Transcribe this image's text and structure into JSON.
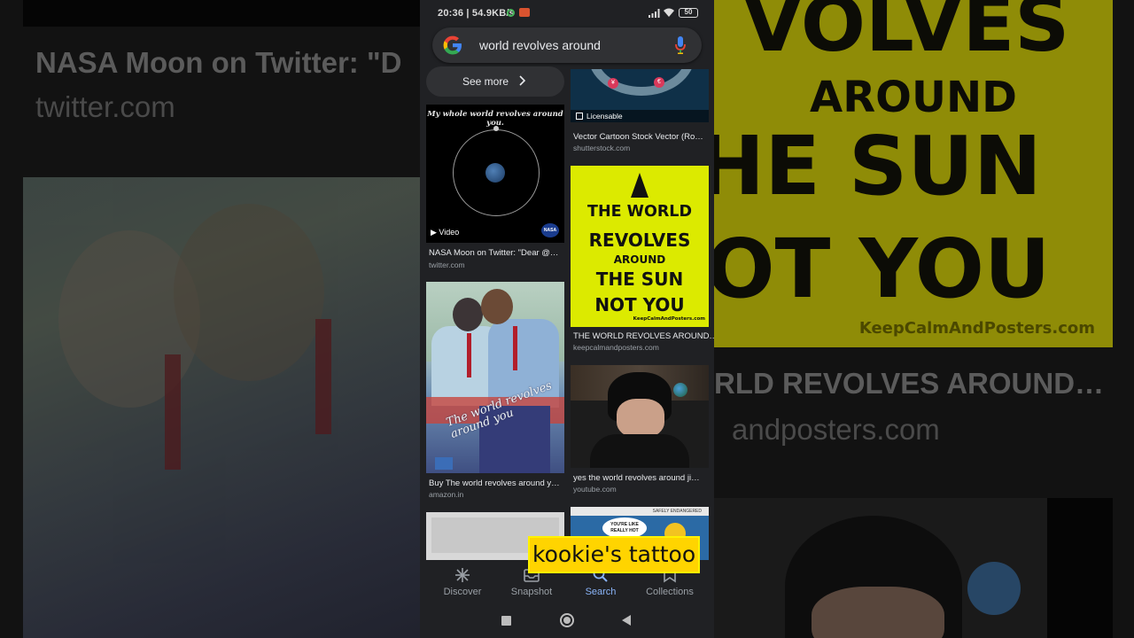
{
  "background": {
    "left_title": "NASA Moon on Twitter: \"D",
    "left_domain": "twitter.com",
    "right_poster_lines": [
      "VOLVES",
      "AROUND",
      "HE SUN",
      "OT YOU",
      "KeepCalmAndPosters.com"
    ],
    "right_title": "RLD REVOLVES AROUND…",
    "right_domain": "andposters.com"
  },
  "statusbar": {
    "time_speed": "20:36 | 54.9KB/s",
    "battery": "50"
  },
  "search": {
    "query": "world revolves around"
  },
  "see_more": {
    "label": "See more"
  },
  "results": {
    "nasa": {
      "caption": "My whole world revolves around you.",
      "badge": "Video",
      "logo": "NASA",
      "title": "NASA Moon on Twitter: \"Dear @…",
      "domain": "twitter.com"
    },
    "manga": {
      "script": "The world revolves around you",
      "title": "Buy The world revolves around y…",
      "domain": "amazon.in"
    },
    "stock": {
      "badge": "Licensable",
      "title": "Vector Cartoon Stock Vector (Ro…",
      "domain": "shutterstock.com"
    },
    "poster": {
      "lines": [
        "THE WORLD",
        "REVOLVES",
        "AROUND",
        "THE SUN",
        "NOT YOU",
        "KeepCalmAndPosters.com"
      ],
      "title": "THE WORLD REVOLVES AROUND…",
      "domain": "keepcalmandposters.com"
    },
    "youtube": {
      "title": "yes the world revolves around ji…",
      "domain": "youtube.com"
    },
    "comic": {
      "header": "SAFELY ENDANGERED",
      "bubble": "YOU'RE LIKE REALLY HOT"
    }
  },
  "overlay_caption": "kookie's tattoo",
  "bottom_nav": [
    {
      "label": "Discover",
      "icon": "asterisk-icon",
      "active": false
    },
    {
      "label": "Snapshot",
      "icon": "inbox-icon",
      "active": false
    },
    {
      "label": "Search",
      "icon": "search-icon",
      "active": true
    },
    {
      "label": "Collections",
      "icon": "bookmark-icon",
      "active": false
    }
  ],
  "colors": {
    "accent": "#8ab4f8",
    "caption_bg": "#ffd400",
    "poster_yellow": "#dcea00"
  }
}
